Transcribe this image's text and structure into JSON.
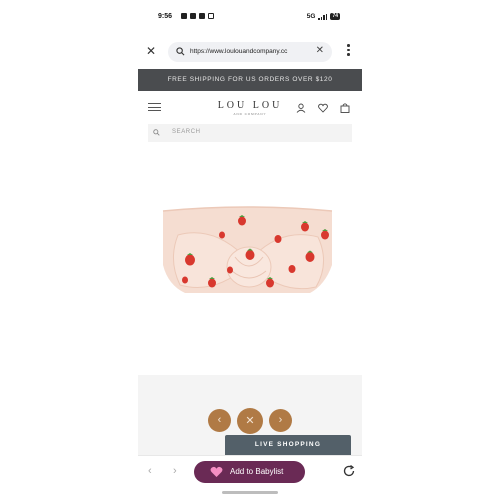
{
  "status_bar": {
    "time": "9:56",
    "network": "5G",
    "battery": "74"
  },
  "browser": {
    "url": "https://www.loulouandcompany.cc"
  },
  "promo": {
    "text": "FREE SHIPPING FOR US ORDERS OVER $120"
  },
  "header": {
    "logo": "LOU LOU",
    "logo_sub": "AND COMPANY"
  },
  "search": {
    "placeholder": "SEARCH"
  },
  "product": {
    "image_icon": "strawberry-bow-headband",
    "colors": {
      "fabric": "#f5ddd1",
      "strawberry": "#d8382e",
      "leaf": "#4f9a3e"
    }
  },
  "gallery": {
    "prev_icon": "chevron-left-icon",
    "close_icon": "close-icon",
    "next_icon": "chevron-right-icon",
    "accent": "#b07a45"
  },
  "live_shopping": {
    "label": "LIVE SHOPPING"
  },
  "bottom_bar": {
    "babylist_label": "Add to Babylist",
    "babylist_color": "#6a2a55"
  }
}
